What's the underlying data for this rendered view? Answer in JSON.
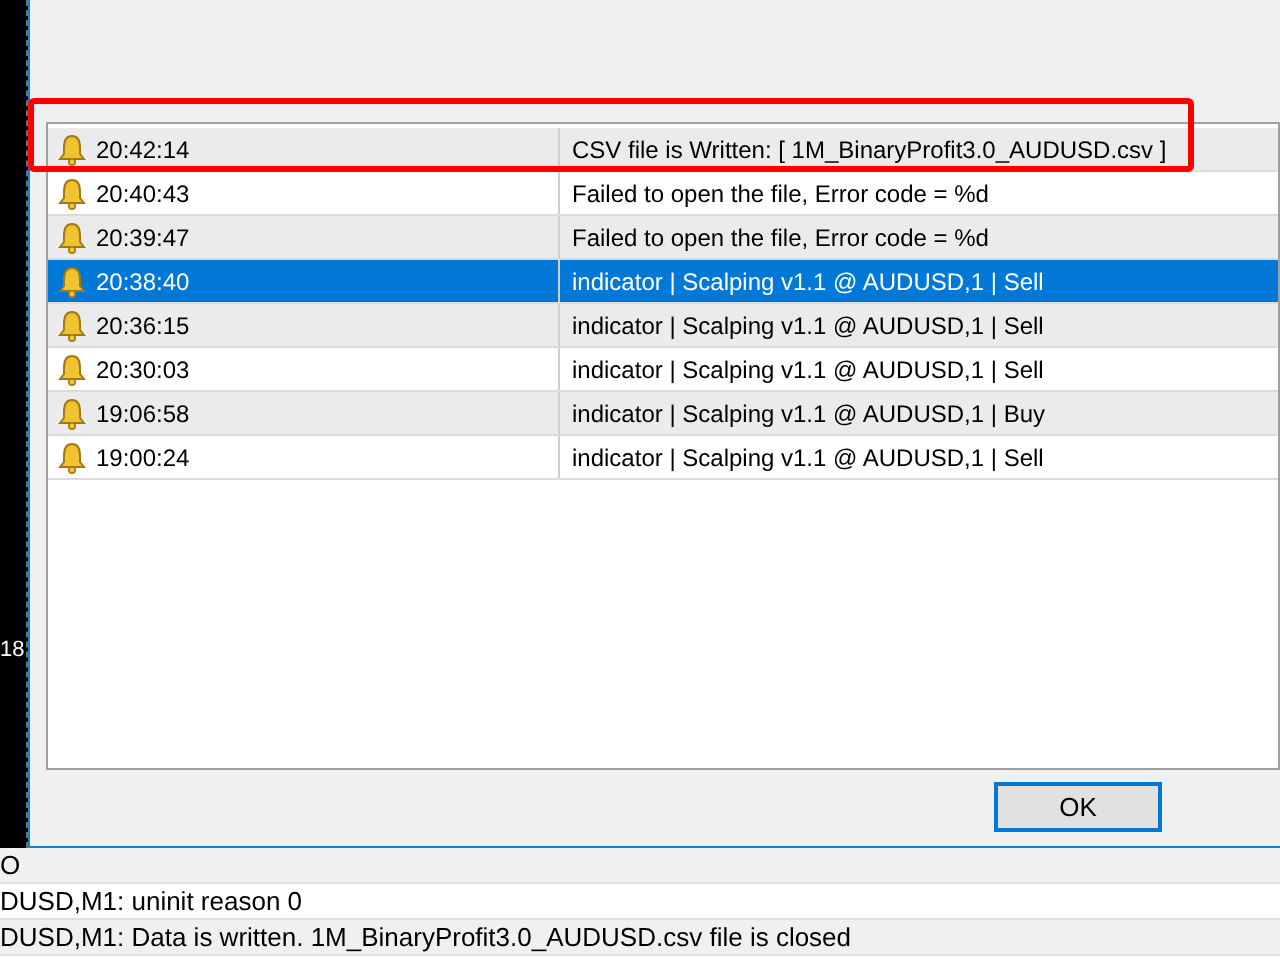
{
  "chart_strip": {
    "price_label": "18"
  },
  "alerts": [
    {
      "time": "20:42:14",
      "message": "CSV file is Written: [ 1M_BinaryProfit3.0_AUDUSD.csv ]",
      "selected": false
    },
    {
      "time": "20:40:43",
      "message": "Failed to open the file, Error code = %d",
      "selected": false
    },
    {
      "time": "20:39:47",
      "message": "Failed to open the file, Error code = %d",
      "selected": false
    },
    {
      "time": "20:38:40",
      "message": "indicator | Scalping v1.1 @ AUDUSD,1 | Sell",
      "selected": true
    },
    {
      "time": "20:36:15",
      "message": "indicator | Scalping v1.1 @ AUDUSD,1 | Sell",
      "selected": false
    },
    {
      "time": "20:30:03",
      "message": "indicator | Scalping v1.1 @ AUDUSD,1 | Sell",
      "selected": false
    },
    {
      "time": "19:06:58",
      "message": "indicator | Scalping v1.1 @ AUDUSD,1 | Buy",
      "selected": false
    },
    {
      "time": "19:00:24",
      "message": "indicator | Scalping v1.1 @ AUDUSD,1 | Sell",
      "selected": false
    }
  ],
  "ok_button": "OK",
  "journal": [
    "O",
    "DUSD,M1: uninit reason 0",
    "DUSD,M1: Data is written. 1M_BinaryProfit3.0_AUDUSD.csv file is closed"
  ]
}
